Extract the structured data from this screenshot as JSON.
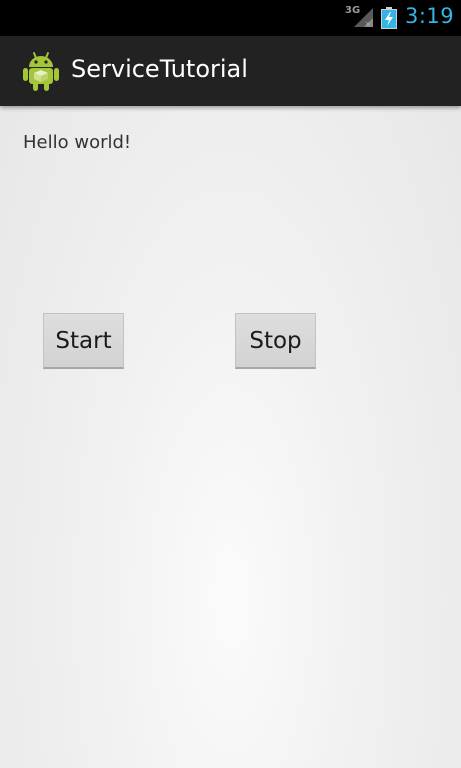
{
  "status_bar": {
    "network_type": "3G",
    "time": "3:19",
    "clock_color": "#33b5e5",
    "icons": [
      "signal-icon",
      "battery-charging-icon"
    ]
  },
  "action_bar": {
    "app_icon": "android-robot-icon",
    "title": "ServiceTutorial",
    "background": "#222222"
  },
  "content": {
    "greeting": "Hello world!",
    "start_label": "Start",
    "stop_label": "Stop"
  }
}
